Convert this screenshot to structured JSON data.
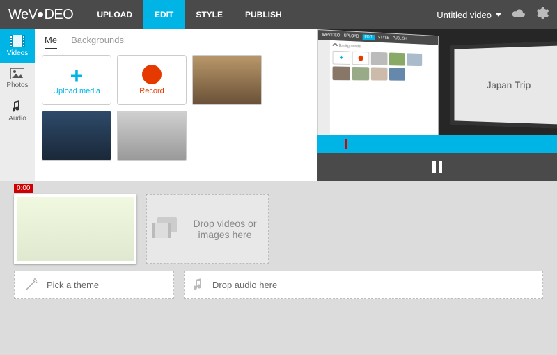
{
  "header": {
    "logo": "WeVIDEO",
    "tabs": [
      "UPLOAD",
      "EDIT",
      "STYLE",
      "PUBLISH"
    ],
    "active_tab": "EDIT",
    "project_name": "Untitled video"
  },
  "sidebar": {
    "items": [
      {
        "label": "Videos",
        "icon": "film-icon"
      },
      {
        "label": "Photos",
        "icon": "photo-icon"
      },
      {
        "label": "Audio",
        "icon": "note-icon"
      }
    ],
    "active": "Videos"
  },
  "media_panel": {
    "tabs": [
      "Me",
      "Backgrounds"
    ],
    "active_tab": "Me",
    "upload_label": "Upload media",
    "record_label": "Record"
  },
  "preview": {
    "mock_header_tabs": [
      "UPLOAD",
      "EDIT",
      "STYLE",
      "PUBLISH"
    ],
    "mock_logo": "WeVIDEO",
    "mock_sidebar": "Backgrounds",
    "screen_text": "Japan Trip"
  },
  "timeline": {
    "time_marker": "0:00",
    "drop_video_text": "Drop videos or images here",
    "pick_theme_label": "Pick a theme",
    "drop_audio_label": "Drop audio here"
  }
}
